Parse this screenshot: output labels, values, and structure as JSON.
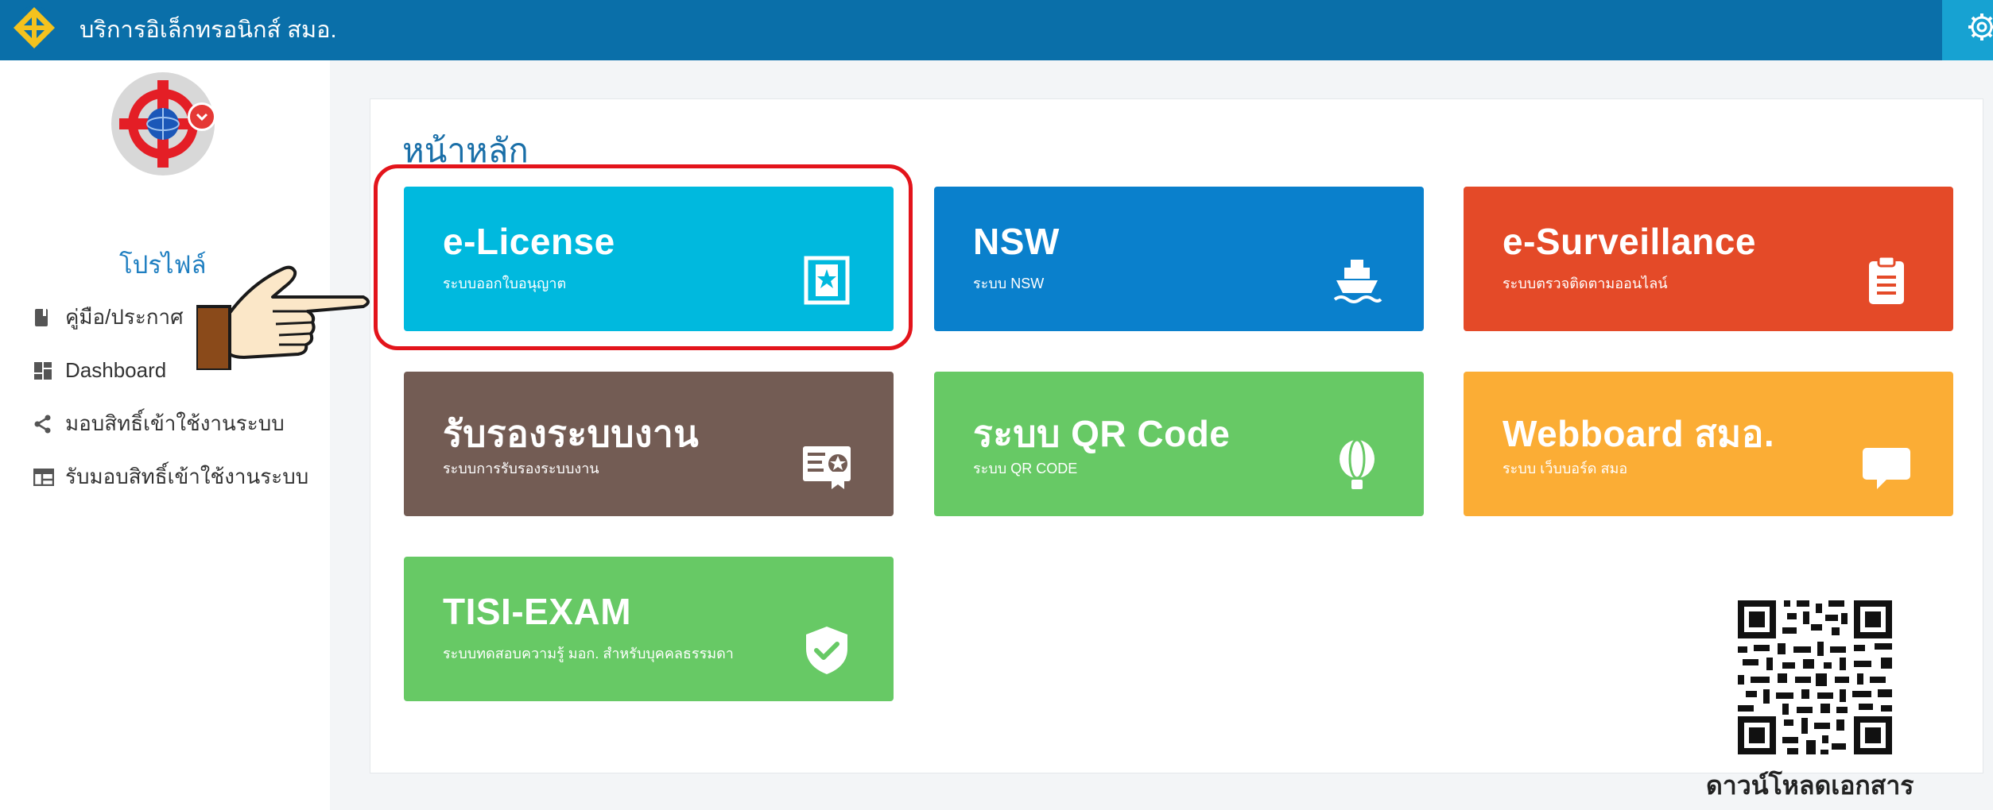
{
  "topbar": {
    "app_title": "บริการอิเล็กทรอนิกส์ สมอ.",
    "logo_icon": "tisi-logo",
    "settings_icon": "gear-icon",
    "bg_color": "#0a6fa9"
  },
  "sidebar": {
    "avatar_icon": "tisi-emblem-avatar",
    "profile_label": "โปรไฟล์",
    "pointer_icon": "pointing-hand-icon",
    "items": [
      {
        "icon": "book-icon",
        "label": "คู่มือ/ประกาศ"
      },
      {
        "icon": "dashboard-icon",
        "label": "Dashboard"
      },
      {
        "icon": "share-icon",
        "label": "มอบสิทธิ์เข้าใช้งานระบบ"
      },
      {
        "icon": "table-icon",
        "label": "รับมอบสิทธิ์เข้าใช้งานระบบ"
      }
    ]
  },
  "main": {
    "page_title": "หน้าหลัก",
    "tiles": [
      {
        "title": "e-License",
        "subtitle": "ระบบออกใบอนุญาต",
        "icon": "license-badge-icon",
        "color": "#00b9de"
      },
      {
        "title": "NSW",
        "subtitle": "ระบบ NSW",
        "icon": "ship-icon",
        "color": "#0a80cc"
      },
      {
        "title": "e-Surveillance",
        "subtitle": "ระบบตรวจติดตามออนไลน์",
        "icon": "clipboard-icon",
        "color": "#e44a28"
      },
      {
        "title": "รับรองระบบงาน",
        "subtitle": "ระบบการรับรองระบบงาน",
        "icon": "certificate-icon",
        "color": "#735c54"
      },
      {
        "title": "ระบบ QR Code",
        "subtitle": "ระบบ QR CODE",
        "icon": "balloon-icon",
        "color": "#67c965"
      },
      {
        "title": "Webboard สมอ.",
        "subtitle": "ระบบ เว็บบอร์ด สมอ",
        "icon": "chat-bubble-icon",
        "color": "#fbad35"
      },
      {
        "title": "TISI-EXAM",
        "subtitle": "ระบบทดสอบความรู้ มอก. สำหรับบุคคลธรรมดา",
        "icon": "shield-check-icon",
        "color": "#67c965"
      }
    ],
    "highlight_color": "#e3141b"
  },
  "download": {
    "qr_icon": "qr-code-icon",
    "caption": "ดาวน์โหลดเอกสาร"
  }
}
